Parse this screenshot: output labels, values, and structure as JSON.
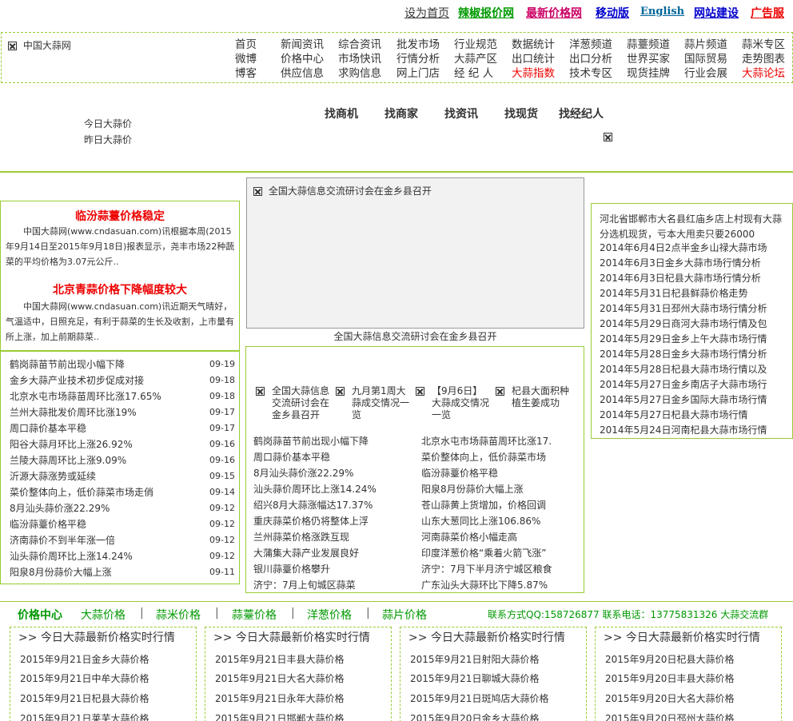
{
  "topbar": {
    "links": [
      {
        "label": "设为首页",
        "color": "#333333"
      },
      {
        "label": "辣椒报价网",
        "color": "#009900"
      },
      {
        "label": "最新价格网",
        "color": "#cc0066"
      },
      {
        "label": "移动版",
        "color": "#0000cc"
      },
      {
        "label": "English",
        "color": "#006699"
      },
      {
        "label": "网站建设",
        "color": "#0000cc"
      },
      {
        "label": "广告服",
        "color": "#ee0000"
      }
    ]
  },
  "nav": {
    "logo_alt": "中国大蒜网",
    "columns": [
      [
        "首页",
        "微博",
        "博客"
      ],
      [
        "新闻资讯",
        "价格中心",
        "供应信息"
      ],
      [
        "综合资讯",
        "市场快讯",
        "求购信息"
      ],
      [
        "批发市场",
        "行情分析",
        "网上门店"
      ],
      [
        "行业规范",
        "大蒜产区",
        "经 纪 人"
      ],
      [
        "数据统计",
        "出口统计",
        "大蒜指数"
      ],
      [
        "洋葱频道",
        "出口分析",
        "技术专区"
      ],
      [
        "蒜薹频道",
        "世界买家",
        "现货挂牌"
      ],
      [
        "蒜片频道",
        "国际贸易",
        "行业会展"
      ],
      [
        "蒜米专区",
        "走势图表",
        "大蒜论坛"
      ]
    ]
  },
  "search": {
    "tabs": [
      "找商机",
      "找商家",
      "找资讯",
      "找现货",
      "找经纪人"
    ],
    "links": [
      "今日大蒜价",
      "昨日大蒜价"
    ]
  },
  "left": {
    "articles": [
      {
        "title": "临汾蒜薹价格稳定",
        "body": "中国大蒜网(www.cndasuan.com)讯根据本周(2015年9月14日至2015年9月18日)报表显示，尧丰市场22种蔬菜的平均价格为3.07元公斤.."
      },
      {
        "title": "北京青蒜价格下降幅度较大",
        "body": "中国大蒜网(www.cndasuan.com)讯近期天气晴好，气温适中，日照充足，有利于蒜菜的生长及收割，上市量有所上涨，加上前期蒜菜.."
      }
    ],
    "news": [
      {
        "title": "鹤岗蒜苗节前出现小幅下降",
        "date": "09-19"
      },
      {
        "title": "金乡大蒜产业技术初步促成对接",
        "date": "09-18"
      },
      {
        "title": "北京水屯市场蒜苗周环比涨17.65%",
        "date": "09-18"
      },
      {
        "title": "兰州大蒜批发价周环比涨19%",
        "date": "09-17"
      },
      {
        "title": "周口蒜价基本平稳",
        "date": "09-17"
      },
      {
        "title": "阳谷大蒜月环比上涨26.92%",
        "date": "09-16"
      },
      {
        "title": "兰陵大蒜周环比上涨9.09%",
        "date": "09-16"
      },
      {
        "title": "沂源大蒜涨势或延续",
        "date": "09-15"
      },
      {
        "title": "菜价整体向上，低价蒜菜市场走俏",
        "date": "09-14"
      },
      {
        "title": "8月汕头蒜价涨22.29%",
        "date": "09-12"
      },
      {
        "title": "临汾蒜薹价格平稳",
        "date": "09-12"
      },
      {
        "title": "济南蒜价不到半年涨一倍",
        "date": "09-12"
      },
      {
        "title": "汕头蒜价周环比上涨14.24%",
        "date": "09-12"
      },
      {
        "title": "阳泉8月份蒜价大幅上涨",
        "date": "09-11"
      }
    ]
  },
  "middle": {
    "photo_alt": "全国大蒜信息交流研讨会在金乡县召开",
    "caption": "全国大蒜信息交流研讨会在金乡县召开",
    "thumbs": [
      "全国大蒜信息交流研讨会在金乡县召开",
      "九月第1周大蒜成交情况一览",
      "【9月6日】大蒜成交情况一览",
      "杞县大面积种植生姜成功"
    ],
    "news_left": [
      "鹤岗蒜苗节前出现小幅下降",
      "周口蒜价基本平稳",
      "8月汕头蒜价涨22.29%",
      "汕头蒜价周环比上涨14.24%",
      "绍兴8月大蒜涨幅达17.37%",
      "重庆蒜菜价格仍将整体上浮",
      "兰州蒜菜价格涨跌互现",
      "大蒲集大蒜产业发展良好",
      "银川蒜薹价格攀升",
      "济宁：7月上旬城区蒜菜"
    ],
    "news_right": [
      "北京水屯市场蒜苗周环比涨17.",
      "菜价整体向上，低价蒜菜市场",
      "临汾蒜薹价格平稳",
      "阳泉8月份蒜价大幅上涨",
      "苍山蒜黄上货增加，价格回调",
      "山东大葱同比上涨106.86%",
      "河南蒜菜价格小幅走高",
      "印度洋葱价格“乘着火箭飞涨”",
      "济宁：7月下半月济宁城区粮食",
      "广东汕头大蒜环比下降5.87%"
    ]
  },
  "right": {
    "lead": "河北省邯郸市大名县红庙乡店上村现有大蒜分选机现货，亏本大甩卖只要26000",
    "list": [
      "2014年6月4日2点半金乡山禄大蒜市场",
      "2014年6月3日金乡大蒜市场行情分析",
      "2014年6月3日杞县大蒜市场行情分析",
      "2014年5月31日杞县鲜蒜价格走势",
      "2014年5月31日邳州大蒜市场行情分析",
      "2014年5月29日商河大蒜市场行情及包",
      "2014年5月29日金乡上午大蒜市场行情",
      "2014年5月28日金乡大蒜市场行情分析",
      "2014年5月28日杞县大蒜市场行情以及",
      "2014年5月27日金乡南店子大蒜市场行",
      "2014年5月27日金乡国际大蒜市场行情",
      "2014年5月27日杞县大蒜市场行情",
      "2014年5月24日河南杞县大蒜市场行情"
    ]
  },
  "price_center": {
    "title": "价格中心",
    "tabs": [
      "大蒜价格",
      "蒜米价格",
      "蒜薹价格",
      "洋葱价格",
      "蒜片价格"
    ],
    "separator": "|",
    "contact": "联系方式QQ:158726877 联系电话：13775831326 大蒜交流群",
    "boxes": [
      {
        "heading": ">> 今日大蒜最新价格实时行情",
        "items": [
          "2015年9月21日金乡大蒜价格",
          "2015年9月21日中牟大蒜价格",
          "2015年9月21日杞县大蒜价格",
          "2015年9月21日莱芜大蒜价格"
        ]
      },
      {
        "heading": ">> 今日大蒜最新价格实时行情",
        "items": [
          "2015年9月21日丰县大蒜价格",
          "2015年9月21日大名大蒜价格",
          "2015年9月21日永年大蒜价格",
          "2015年9月21日邯郸大蒜价格"
        ]
      },
      {
        "heading": ">> 今日大蒜最新价格实时行情",
        "items": [
          "2015年9月21日射阳大蒜价格",
          "2015年9月21日聊城大蒜价格",
          "2015年9月21日斑鸠店大蒜价格",
          "2015年9月20日金乡大蒜价格"
        ]
      },
      {
        "heading": ">> 今日大蒜最新价格实时行情",
        "items": [
          "2015年9月20日杞县大蒜价格",
          "2015年9月20日丰县大蒜价格",
          "2015年9月20日大名大蒜价格",
          "2015年9月20日邳州大蒜价格"
        ]
      }
    ]
  }
}
